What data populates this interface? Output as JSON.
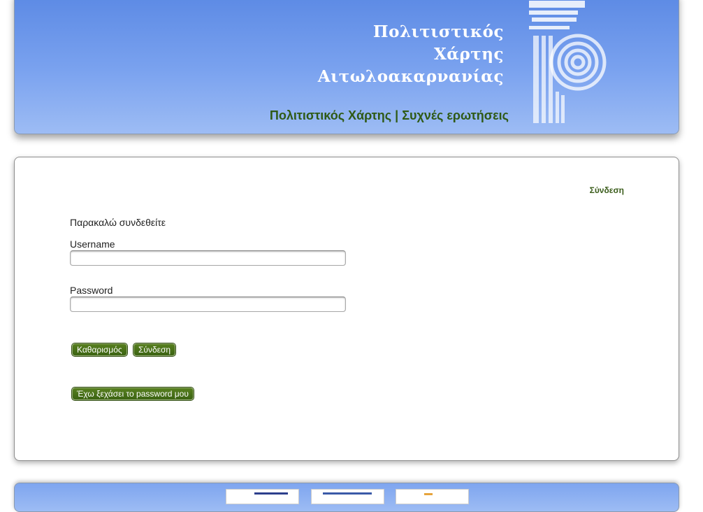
{
  "header": {
    "title_lines": [
      "Πολιτιστικός",
      "Χάρτης",
      "Αιτωλοακαρνανίας"
    ],
    "nav": {
      "map_link": "Πολιτιστικός Χάρτης",
      "separator": "|",
      "faq_link": "Συχνές ερωτήσεις"
    },
    "logo_icon": "ionic-column-icon"
  },
  "main": {
    "top_login_link": "Σύνδεση",
    "prompt": "Παρακαλώ συνδεθείτε",
    "username_label": "Username",
    "username_value": "",
    "password_label": "Password",
    "password_value": "",
    "clear_button": "Καθαρισμός",
    "login_button": "Σύνδεση",
    "forgot_button": "Έχω ξεχάσει το password μου"
  },
  "footer": {
    "logos": [
      "logo-1",
      "logo-2",
      "logo-3"
    ]
  },
  "colors": {
    "header_blue": "#6d97ea",
    "nav_green": "#2f5a16",
    "button_green": "#4a711a"
  }
}
